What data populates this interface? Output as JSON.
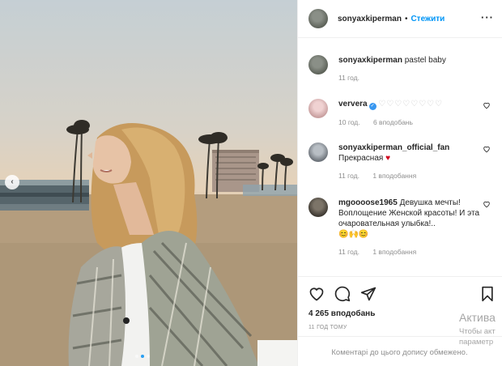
{
  "header": {
    "username": "sonyaxkiperman",
    "separator": "•",
    "follow_label": "Стежити",
    "more_label": "···"
  },
  "comments": [
    {
      "username": "sonyaxkiperman",
      "text": "pastel baby",
      "time": "11 год.",
      "likes": "",
      "reply": ""
    },
    {
      "username": "ververa",
      "verified": true,
      "text": "♡♡♡♡♡♡♡♡",
      "time": "10 год.",
      "likes": "6 вподобань"
    },
    {
      "username": "sonyaxkiperman_official_fan",
      "text": "Прекрасная",
      "emoji": "♥",
      "time": "11 год.",
      "likes": "1 вподобання"
    },
    {
      "username": "mgoooose1965",
      "text": "Девушка мечты! Воплощение Женской красоты! И эта очаровательная улыбка!..",
      "emoji": "😊🙌😊",
      "time": "11 год.",
      "likes": "1 вподобання"
    }
  ],
  "actions": {
    "likes_count": "4 265 вподобань",
    "posted": "11 ГОД ТОМУ"
  },
  "comments_limited": "Коментарі до цього допису обмежено.",
  "windows_activation": {
    "title": "Актива",
    "line1": "Чтобы акт",
    "line2": "параметр"
  },
  "carousel": {
    "slide_count": 3,
    "active_slide": 2
  },
  "colors": {
    "accent": "#0095f6",
    "secondary_text": "#8e8e8e",
    "heart_red": "#d0021b"
  }
}
